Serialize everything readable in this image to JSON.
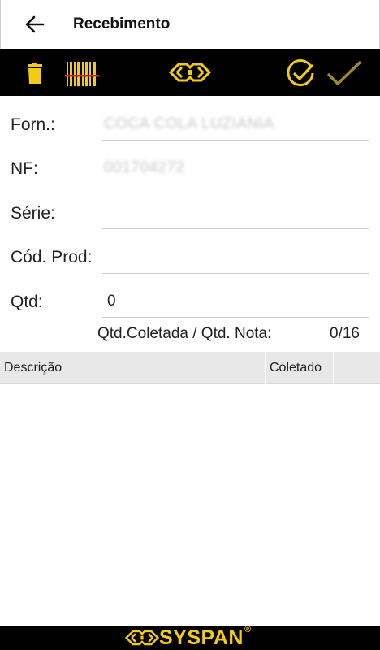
{
  "appbar": {
    "title": "Recebimento",
    "back_icon": "arrow-left-icon"
  },
  "toolbar": {
    "delete_icon": "trash-icon",
    "scan_icon": "barcode-scan-icon",
    "logo_icon": "syspan-logo-icon",
    "check_all_icon": "check-circle-icon",
    "confirm_icon": "check-icon",
    "accent_color": "#f2cb17",
    "muted_accent_color": "#a08a2e"
  },
  "form": {
    "fornecedor": {
      "label": "Forn.:",
      "value": "COCA COLA LUZIANIA"
    },
    "nf": {
      "label": "NF:",
      "value": "001704272"
    },
    "serie": {
      "label": "Série:",
      "value": ""
    },
    "cod_prod": {
      "label": "Cód. Prod:",
      "value": ""
    },
    "qtd": {
      "label": "Qtd:",
      "value": "0"
    }
  },
  "summary": {
    "label": "Qtd.Coletada / Qtd. Nota:",
    "value": "0/16"
  },
  "table": {
    "columns": [
      "Descrição",
      "Coletado"
    ],
    "rows": []
  },
  "footer": {
    "brand": "SYSPAN",
    "registered": "®"
  }
}
